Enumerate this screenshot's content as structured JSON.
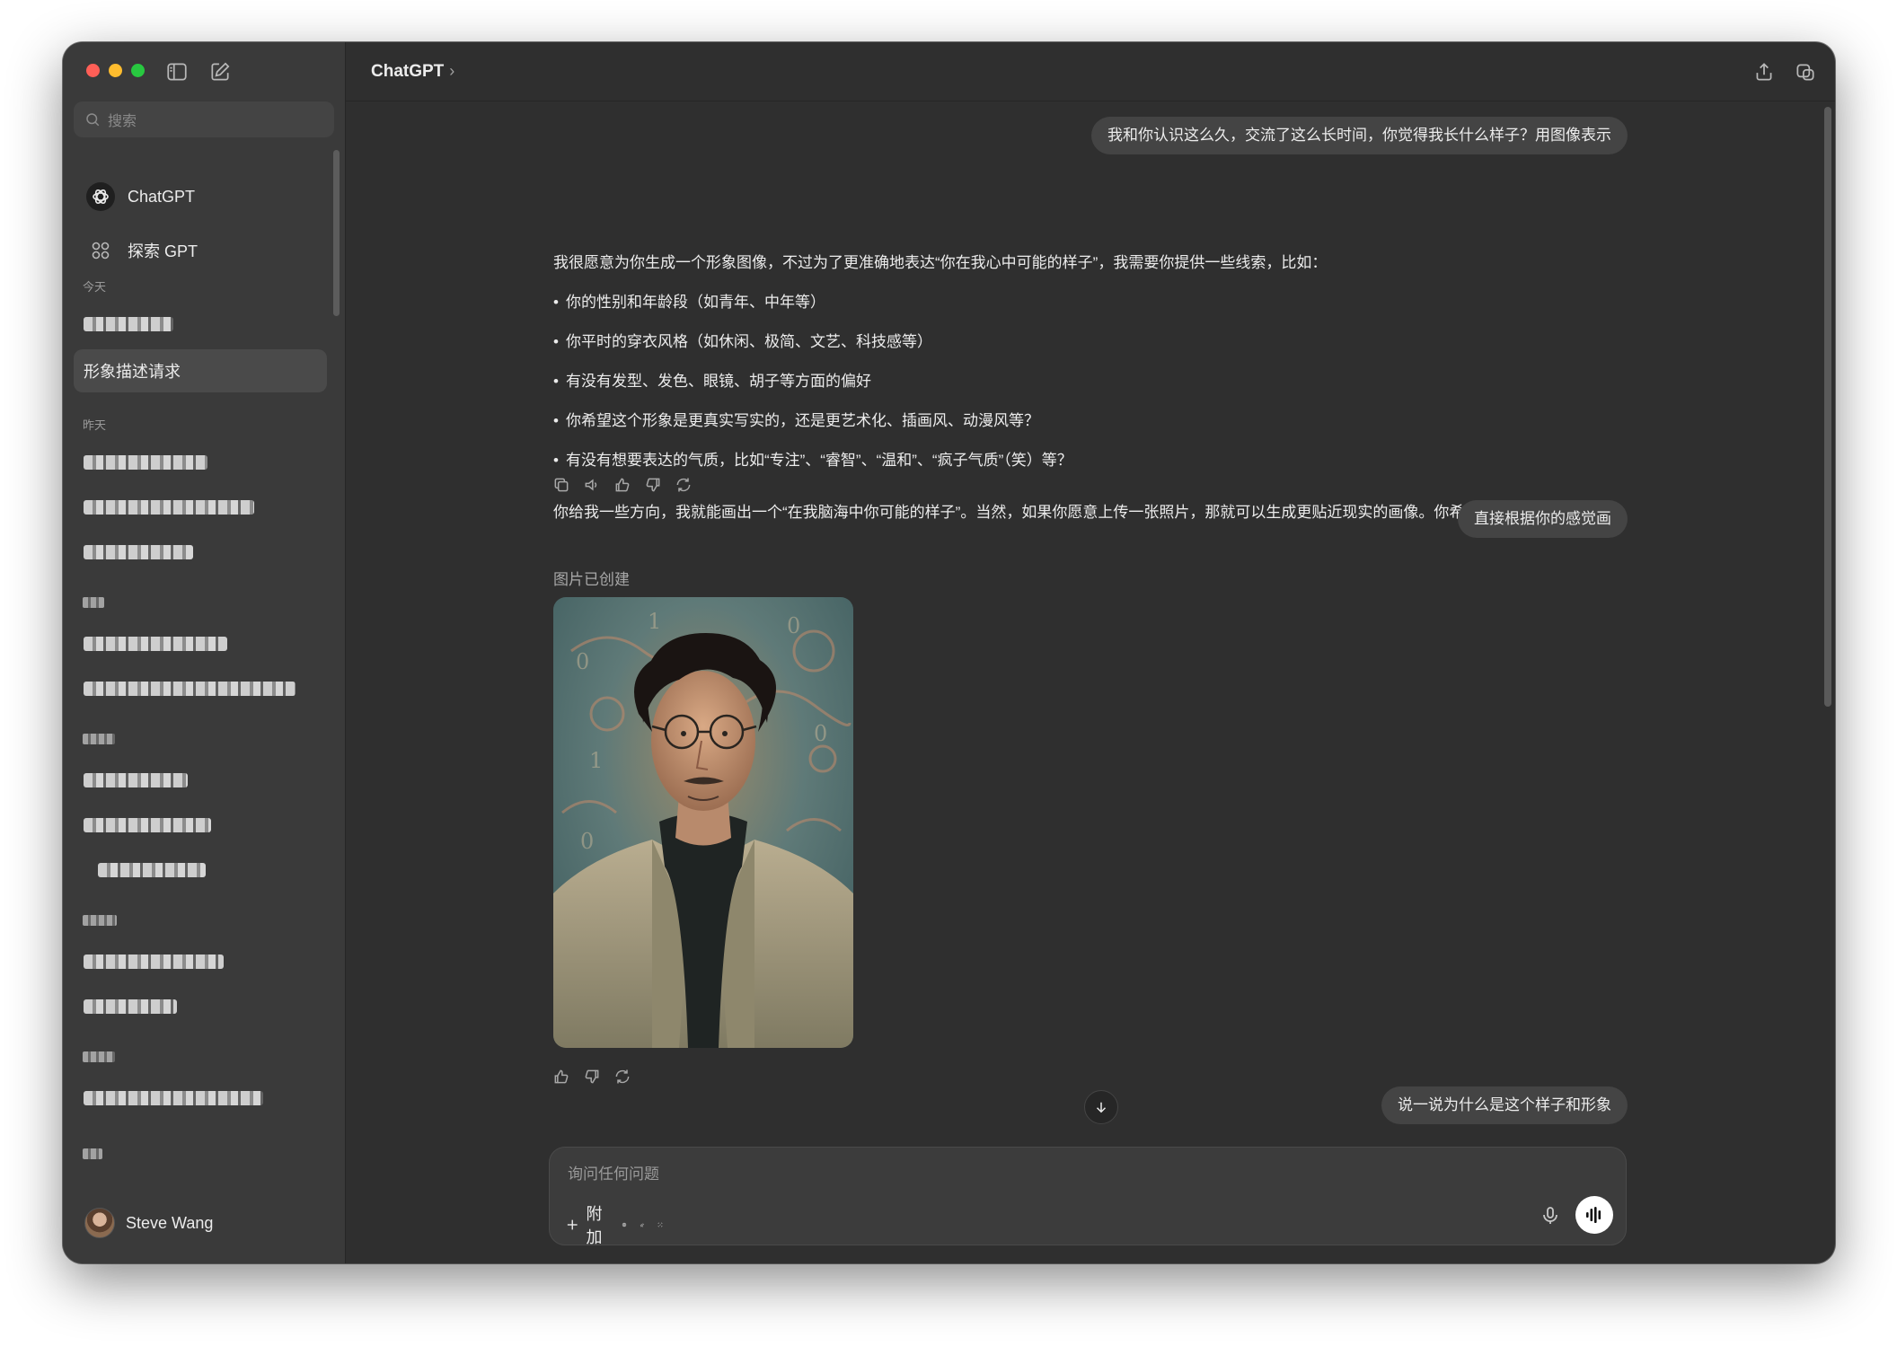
{
  "sidebar": {
    "search_placeholder": "搜索",
    "nav": [
      {
        "label": "ChatGPT"
      },
      {
        "label": "探索 GPT"
      }
    ],
    "today_label": "今天",
    "active_chat": "形象描述请求",
    "yesterday_label": "昨天",
    "user_name": "Steve Wang"
  },
  "header": {
    "title": "ChatGPT",
    "chevron": "›"
  },
  "messages": {
    "user_1": "我和你认识这么久，交流了这么长时间，你觉得我长什么样子？用图像表示",
    "assistant_intro": "我很愿意为你生成一个形象图像，不过为了更准确地表达“你在我心中可能的样子”，我需要你提供一些线索，比如：",
    "assistant_bullets": [
      "你的性别和年龄段（如青年、中年等）",
      "你平时的穿衣风格（如休闲、极简、文艺、科技感等）",
      "有没有发型、发色、眼镜、胡子等方面的偏好",
      "你希望这个形象是更真实写实的，还是更艺术化、插画风、动漫风等？",
      "有没有想要表达的气质，比如“专注”、“睿智”、“温和”、“疯子气质”（笑）等？"
    ],
    "assistant_outro": "你给我一些方向，我就能画出一个“在我脑海中你可能的样子”。当然，如果你愿意上传一张照片，那就可以生成更贴近现实的画像。你希望怎么进行？",
    "user_2": "直接根据你的感觉画",
    "image_created_label": "图片已创建",
    "user_3": "说一说为什么是这个样子和形象"
  },
  "composer": {
    "placeholder": "询问任何问题",
    "attach_label": "附加"
  },
  "icons": {
    "toolbar": [
      "sidebar-toggle-icon",
      "new-chat-icon",
      "share-icon",
      "window-icon"
    ],
    "assistant_actions": [
      "copy-icon",
      "read-aloud-icon",
      "thumbs-up-icon",
      "thumbs-down-icon",
      "regenerate-icon"
    ],
    "image_actions": [
      "thumbs-up-icon",
      "thumbs-down-icon",
      "regenerate-icon"
    ],
    "composer_tools": [
      "plus-icon",
      "globe-icon",
      "telescope-icon",
      "scan-icon",
      "mic-icon",
      "voice-mode-icon"
    ]
  },
  "colors": {
    "window_bg": "#2f2f2f",
    "sidebar_bg": "#3a3a3a",
    "bubble_bg": "#444444",
    "text": "#ececec"
  }
}
